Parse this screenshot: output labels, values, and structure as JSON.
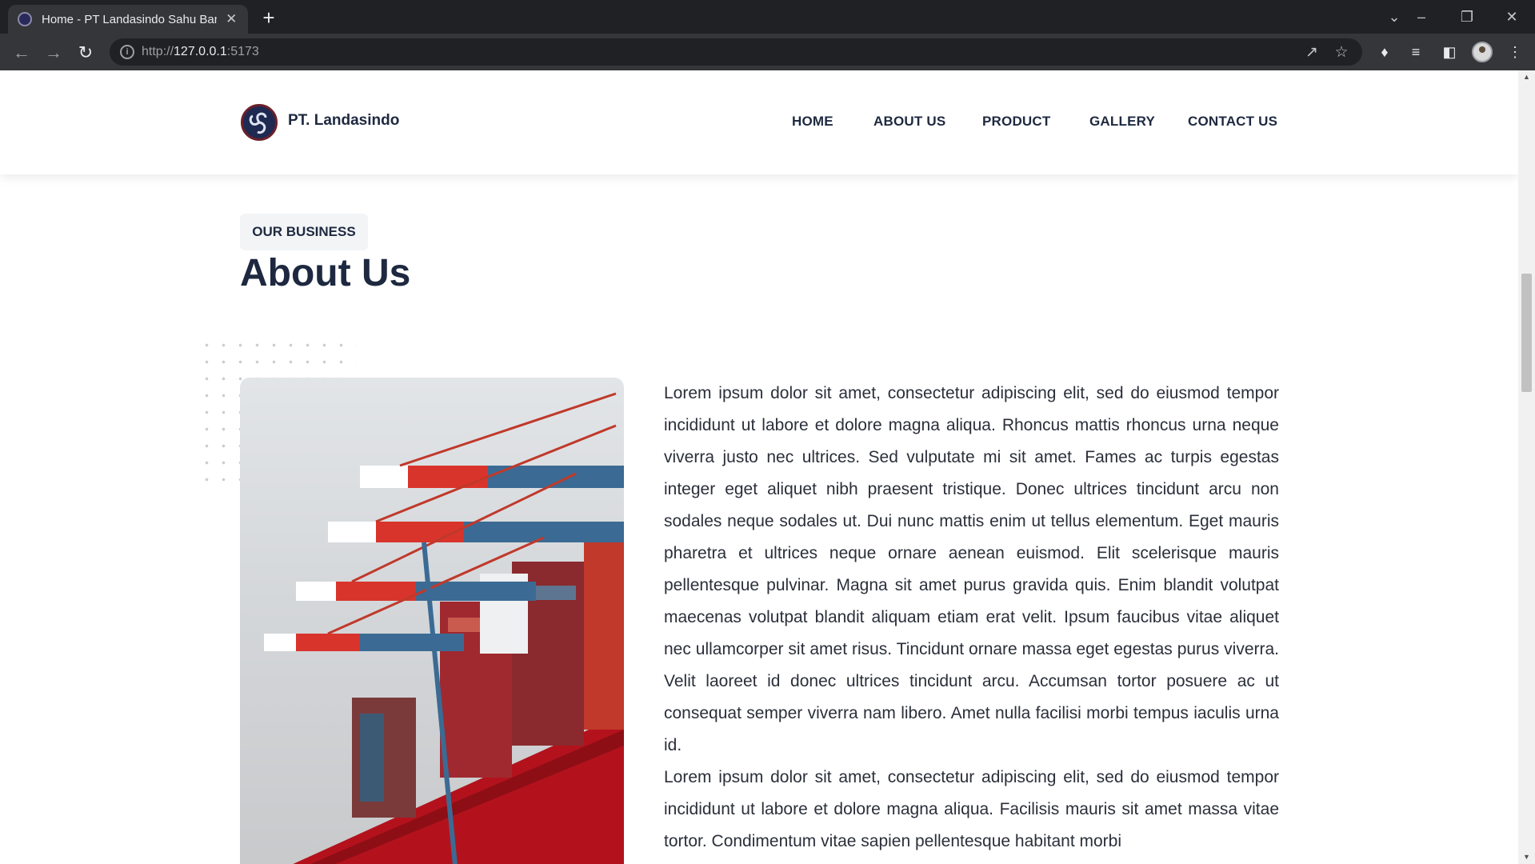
{
  "browser": {
    "tab_title": "Home - PT Landasindo Sahu Baru",
    "url_scheme": "http://",
    "url_host": "127.0.0.1",
    "url_port": ":5173",
    "new_tab_glyph": "+",
    "close_glyph": "✕"
  },
  "site": {
    "brand": "PT. Landasindo",
    "nav": {
      "home": "HOME",
      "about": "ABOUT US",
      "product": "PRODUCT",
      "gallery": "GALLERY",
      "contact": "CONTACT US"
    }
  },
  "about": {
    "badge": "OUR BUSINESS",
    "title": "About Us",
    "paragraph_1": "Lorem ipsum dolor sit amet, consectetur adipiscing elit, sed do eiusmod tempor incididunt ut labore et dolore magna aliqua. Rhoncus mattis rhoncus urna neque viverra justo nec ultrices. Sed vulputate mi sit amet. Fames ac turpis egestas integer eget aliquet nibh praesent tristique. Donec ultrices tincidunt arcu non sodales neque sodales ut. Dui nunc mattis enim ut tellus elementum. Eget mauris pharetra et ultrices neque ornare aenean euismod. Elit scelerisque mauris pellentesque pulvinar. Magna sit amet purus gravida quis. Enim blandit volutpat maecenas volutpat blandit aliquam etiam erat velit. Ipsum faucibus vitae aliquet nec ullamcorper sit amet risus. Tincidunt ornare massa eget egestas purus viverra. Velit laoreet id donec ultrices tincidunt arcu. Accumsan tortor posuere ac ut consequat semper viverra nam libero. Amet nulla facilisi morbi tempus iaculis urna id.",
    "paragraph_2": "Lorem ipsum dolor sit amet, consectetur adipiscing elit, sed do eiusmod tempor incididunt ut labore et dolore magna aliqua. Facilisis mauris sit amet massa vitae tortor. Condimentum vitae sapien pellentesque habitant morbi"
  },
  "icons": {
    "back": "arrow-left-icon",
    "forward": "arrow-right-icon",
    "reload": "reload-icon",
    "info": "info-icon",
    "share": "share-icon",
    "bookmark": "star-icon",
    "extensions": "puzzle-icon",
    "media": "media-queue-icon",
    "sidepanel": "side-panel-icon",
    "menu": "kebab-menu-icon"
  },
  "colors": {
    "navy": "#1e2940",
    "chrome_dark": "#202124",
    "chrome_toolbar": "#35363a",
    "ship_red": "#b3121c"
  }
}
